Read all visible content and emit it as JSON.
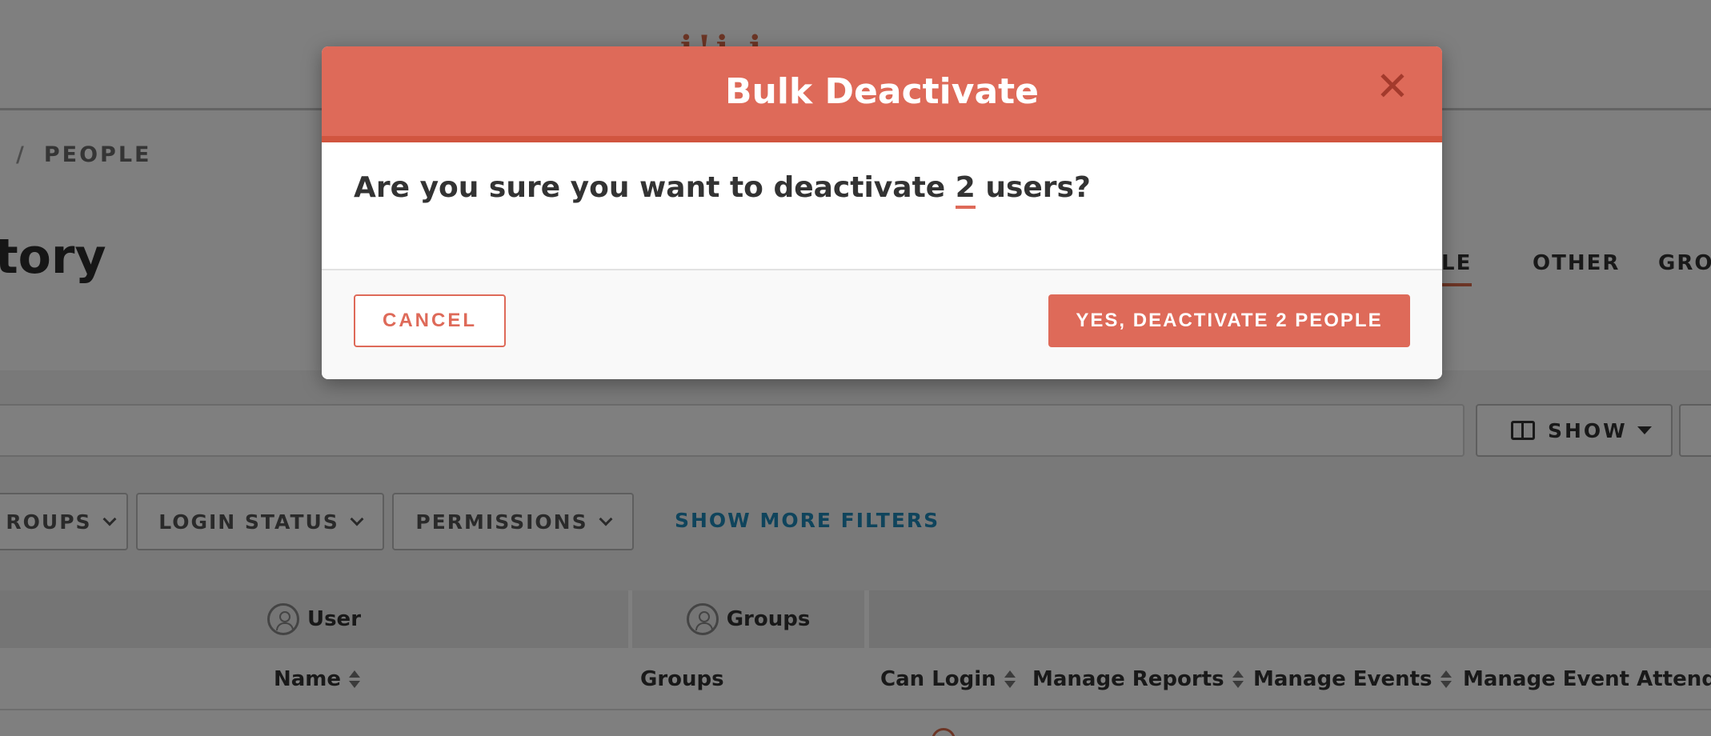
{
  "background": {
    "logo_text": "i!i.i",
    "breadcrumb": {
      "separator": "/",
      "current": "PEOPLE"
    },
    "page_title": "tory",
    "tabs": [
      {
        "label": "PLE",
        "active": true
      },
      {
        "label": "OTHER",
        "active": false
      },
      {
        "label": "GRO",
        "active": false
      }
    ],
    "toolbar": {
      "show_label": "SHOW"
    },
    "filters": [
      {
        "label": "ROUPS"
      },
      {
        "label": "LOGIN STATUS"
      },
      {
        "label": "PERMISSIONS"
      }
    ],
    "show_more_filters": "SHOW MORE FILTERS",
    "group_headers": {
      "user": "User",
      "groups": "Groups"
    },
    "columns": {
      "name": "Name",
      "groups": "Groups",
      "can_login": "Can Login",
      "manage_reports": "Manage Reports",
      "manage_events": "Manage Events",
      "manage_event_attendance": "Manage Event Attendance"
    }
  },
  "modal": {
    "title": "Bulk Deactivate",
    "close_icon": "close-icon",
    "question_prefix": "Are you sure you want to deactivate ",
    "question_count": "2",
    "question_suffix": " users?",
    "cancel_label": "CANCEL",
    "confirm_label": "YES, DEACTIVATE 2 PEOPLE"
  },
  "colors": {
    "accent": "#de6a59",
    "accent_dark": "#d1553f",
    "link": "#1e88b8"
  }
}
